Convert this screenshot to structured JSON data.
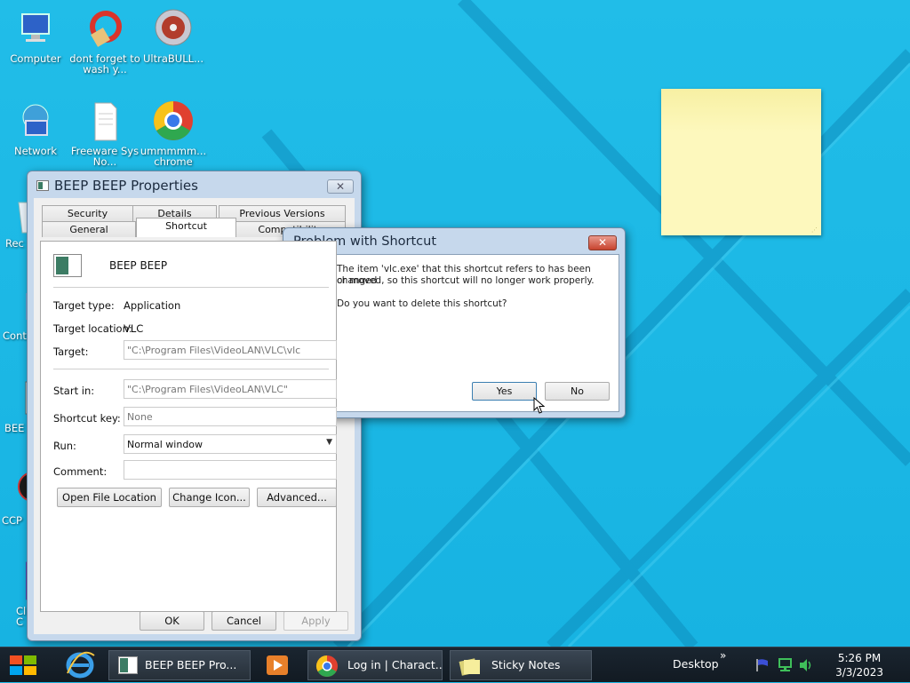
{
  "desktop": {
    "icons": [
      {
        "label": "Computer"
      },
      {
        "label": "dont forget to wash y..."
      },
      {
        "label": "UltraBULL..."
      },
      {
        "label": "Network"
      },
      {
        "label": "Freeware Sys No..."
      },
      {
        "label": "ummmmm... chrome"
      },
      {
        "label": "Rec"
      },
      {
        "label": "Cont"
      },
      {
        "label": "BEE"
      },
      {
        "label": "CCP"
      },
      {
        "label": "Cl C"
      }
    ]
  },
  "properties": {
    "title": "BEEP BEEP Properties",
    "tabs_row1": [
      "Security",
      "Details",
      "Previous Versions"
    ],
    "tabs_row2": [
      "General",
      "Shortcut",
      "Compatibility"
    ],
    "name": "BEEP BEEP",
    "target_type_label": "Target type:",
    "target_type_value": "Application",
    "target_location_label": "Target location:",
    "target_location_value": "VLC",
    "target_label": "Target:",
    "target_value": "\"C:\\Program Files\\VideoLAN\\VLC\\vlc",
    "start_in_label": "Start in:",
    "start_in_value": "\"C:\\Program Files\\VideoLAN\\VLC\"",
    "shortcut_key_label": "Shortcut key:",
    "shortcut_key_value": "None",
    "run_label": "Run:",
    "run_value": "Normal window",
    "comment_label": "Comment:",
    "comment_value": "",
    "open_file_location": "Open File Location",
    "change_icon": "Change Icon...",
    "advanced": "Advanced...",
    "ok": "OK",
    "cancel": "Cancel",
    "apply": "Apply"
  },
  "problem_dialog": {
    "title": "Problem with Shortcut",
    "message_line1": "The item 'vlc.exe' that this shortcut refers to has been changed",
    "message_line2": "or moved, so this shortcut will no longer work properly.",
    "question": "Do you want to delete this shortcut?",
    "yes": "Yes",
    "no": "No",
    "close": "✕"
  },
  "taskbar": {
    "items": [
      {
        "label": "BEEP BEEP Pro..."
      },
      {
        "label": "Log in | Charact..."
      },
      {
        "label": "Sticky Notes"
      }
    ],
    "desktop_label": "Desktop",
    "chevron": "»",
    "time": "5:26 PM",
    "date": "3/3/2023"
  },
  "colors": {
    "desktop_bg": "#1cb6e3",
    "sticky_note": "#fdf8bd",
    "taskbar": "#121a22",
    "dialog_close": "#c7432e"
  }
}
